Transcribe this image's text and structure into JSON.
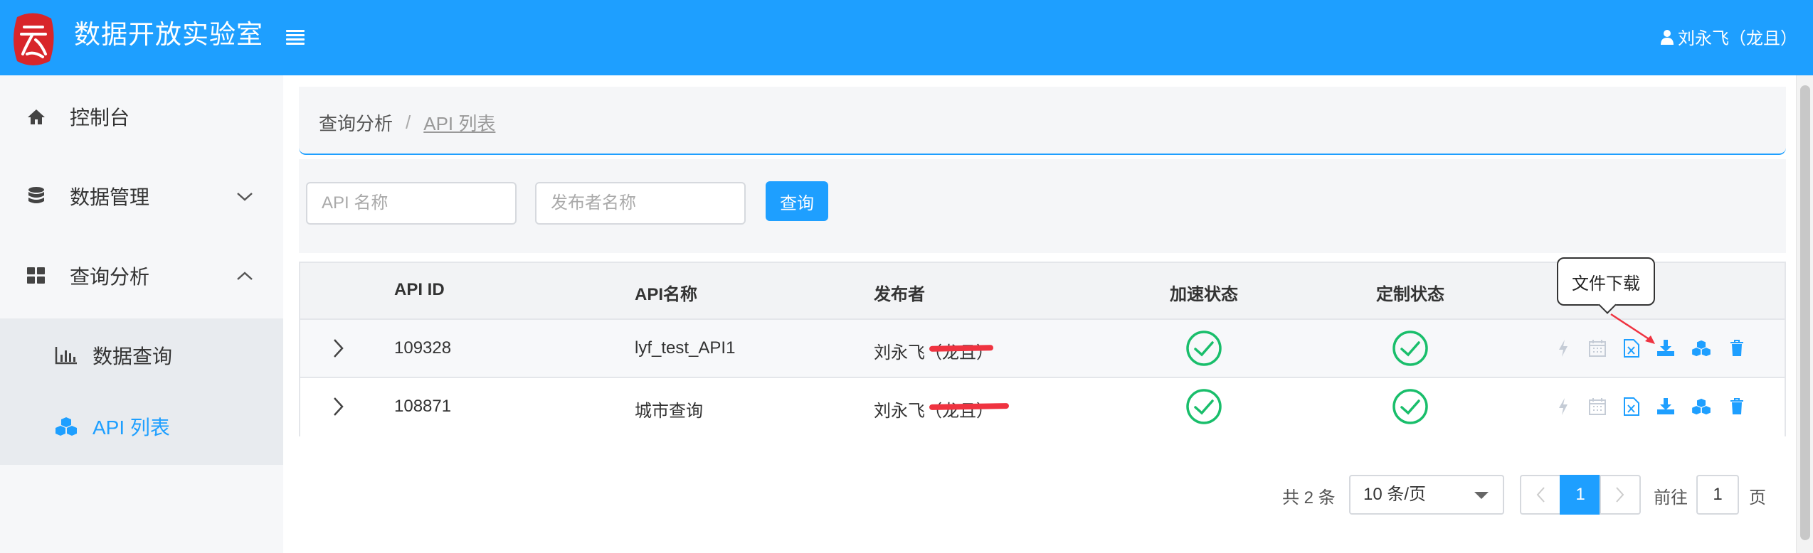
{
  "header": {
    "app_title": "数据开放实验室",
    "user_name": "刘永飞（龙且）"
  },
  "sidebar": {
    "items": [
      {
        "label": "控制台",
        "icon": "home-icon"
      },
      {
        "label": "数据管理",
        "icon": "database-icon",
        "expanded": false
      },
      {
        "label": "查询分析",
        "icon": "grid-icon",
        "expanded": true
      }
    ],
    "subitems": [
      {
        "label": "数据查询",
        "icon": "bar-chart-icon",
        "active": false
      },
      {
        "label": "API 列表",
        "icon": "cubes-icon",
        "active": true
      }
    ]
  },
  "breadcrumb": {
    "parent": "查询分析",
    "separator": "/",
    "current": "API 列表"
  },
  "search": {
    "api_name_placeholder": "API 名称",
    "publisher_placeholder": "发布者名称",
    "query_label": "查询"
  },
  "table": {
    "columns": [
      "API ID",
      "API名称",
      "发布者",
      "加速状态",
      "定制状态"
    ],
    "rows": [
      {
        "api_id": "109328",
        "api_name": "lyf_test_API1",
        "publisher": "刘永飞（龙且）",
        "accel": "enabled",
        "custom": "enabled"
      },
      {
        "api_id": "108871",
        "api_name": "城市查询",
        "publisher": "刘永飞（龙且）",
        "accel": "enabled",
        "custom": "enabled"
      }
    ],
    "actions": [
      "bolt-icon",
      "calendar-icon",
      "excel-file-icon",
      "download-icon",
      "cubes-icon",
      "trash-icon"
    ]
  },
  "tooltip": {
    "text": "文件下载"
  },
  "pagination": {
    "total_text": "共 2 条",
    "page_size": "10 条/页",
    "current_page": "1",
    "goto_label": "前往",
    "goto_value": "1",
    "page_suffix": "页"
  },
  "colors": {
    "primary": "#1e9fff",
    "success": "#19be6b",
    "redaction": "#ef3340"
  }
}
